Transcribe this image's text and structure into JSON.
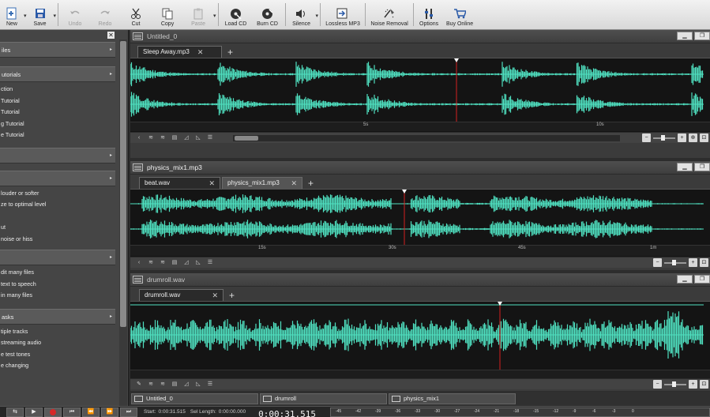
{
  "toolbar": {
    "buttons": [
      {
        "label": "New",
        "icon": "new-file-icon",
        "enabled": true
      },
      {
        "label": "Save",
        "icon": "floppy-icon",
        "enabled": true
      },
      {
        "label": "Undo",
        "icon": "undo-icon",
        "enabled": false
      },
      {
        "label": "Redo",
        "icon": "redo-icon",
        "enabled": false
      },
      {
        "label": "Cut",
        "icon": "scissors-icon",
        "enabled": true
      },
      {
        "label": "Copy",
        "icon": "copy-icon",
        "enabled": true
      },
      {
        "label": "Paste",
        "icon": "paste-icon",
        "enabled": false
      },
      {
        "label": "Load CD",
        "icon": "cd-load-icon",
        "enabled": true
      },
      {
        "label": "Burn CD",
        "icon": "cd-burn-icon",
        "enabled": true
      },
      {
        "label": "Silence",
        "icon": "speaker-icon",
        "enabled": true
      },
      {
        "label": "Lossless MP3",
        "icon": "lossless-mp3-icon",
        "enabled": true
      },
      {
        "label": "Noise Removal",
        "icon": "noise-removal-icon",
        "enabled": true
      },
      {
        "label": "Options",
        "icon": "options-icon",
        "enabled": true
      },
      {
        "label": "Buy Online",
        "icon": "cart-icon",
        "enabled": true
      }
    ]
  },
  "left_pane": {
    "sections": [
      {
        "title": "iles",
        "items": []
      },
      {
        "title": "utorials",
        "items": [
          "ction",
          "Tutorial",
          "Tutorial",
          "g Tutorial",
          "e Tutorial"
        ]
      },
      {
        "title": "",
        "items": []
      },
      {
        "title": "",
        "items": [
          "louder or softer",
          "ze to optimal level",
          "",
          "ut",
          " noise or hiss"
        ]
      },
      {
        "title": "",
        "items": [
          "dit many files",
          " text to speech",
          "in many files"
        ]
      },
      {
        "title": "asks",
        "items": [
          "tiple tracks",
          "streaming audio",
          "e test tones",
          "e changing"
        ]
      }
    ]
  },
  "editors": [
    {
      "title": "Untitled_0",
      "active": false,
      "tabs": [
        {
          "label": "Sleep Away.mp3",
          "selected": true
        }
      ],
      "ruler": [
        "5s",
        "10s"
      ]
    },
    {
      "title": "physics_mix1.mp3",
      "active": true,
      "tabs": [
        {
          "label": "beat.wav",
          "selected": true
        },
        {
          "label": "physics_mix1.mp3",
          "selected": false
        }
      ],
      "ruler": [
        "15s",
        "30s",
        "45s",
        "1m"
      ]
    },
    {
      "title": "drumroll.wav",
      "active": false,
      "tabs": [
        {
          "label": "drumroll.wav",
          "selected": true
        }
      ],
      "ruler": []
    }
  ],
  "doc_tabs": [
    "Untitled_0",
    "drumroll",
    "physics_mix1"
  ],
  "status": {
    "start_label": "Start:",
    "start_value": "0:00:31.515",
    "sel_length_label": "Sel Length:",
    "sel_length_value": "0:00:00.000",
    "timer": "0:00:31.515",
    "meter_ticks": [
      "-45",
      "-42",
      "-39",
      "-36",
      "-33",
      "-30",
      "-27",
      "-24",
      "-21",
      "-18",
      "-15",
      "-12",
      "-9",
      "-6",
      "-3",
      "0"
    ]
  },
  "colors": {
    "waveform": "#4fe0c0",
    "cursor": "#d42020",
    "toolbar_bg": "#e4e4e4"
  }
}
